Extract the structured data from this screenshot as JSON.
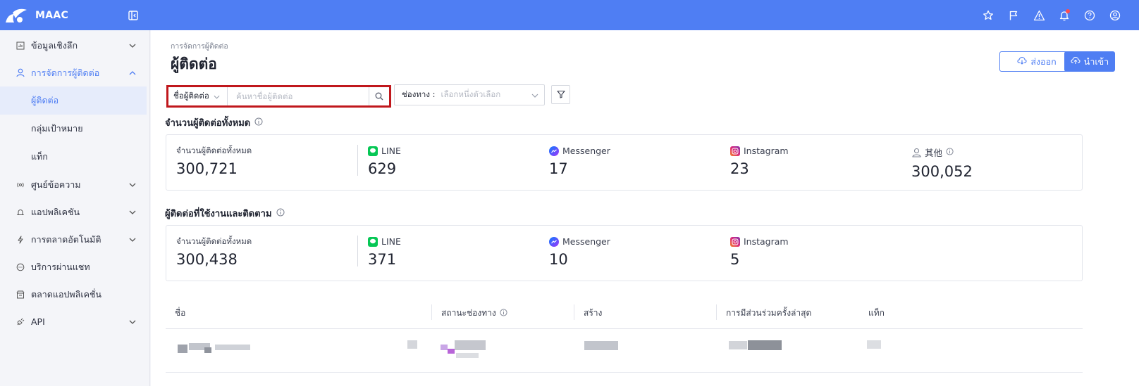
{
  "app": {
    "name": "MAAC",
    "brand_color": "#4f7ef3",
    "top_icons": [
      "star-icon",
      "flag-icon",
      "alert-icon",
      "bell-icon",
      "help-icon",
      "user-icon"
    ]
  },
  "sidebar": {
    "items": [
      {
        "label": "ข้อมูลเชิงลึก",
        "icon": "chart-icon",
        "has_chevron": true
      },
      {
        "label": "การจัดการผู้ติดต่อ",
        "icon": "person-icon",
        "has_chevron": true,
        "expanded": true
      },
      {
        "label": "ศูนย์ข้อความ",
        "icon": "broadcast-icon",
        "has_chevron": true
      },
      {
        "label": "แอปพลิเคชัน",
        "icon": "bell-icon",
        "has_chevron": true
      },
      {
        "label": "การตลาดอัตโนมัติ",
        "icon": "bolt-icon",
        "has_chevron": true
      },
      {
        "label": "บริการผ่านแชท",
        "icon": "chat-icon",
        "has_chevron": false
      },
      {
        "label": "ตลาดแอปพลิเคชั่น",
        "icon": "store-icon",
        "has_chevron": false
      },
      {
        "label": "API",
        "icon": "plug-icon",
        "has_chevron": true
      }
    ],
    "sub_items": [
      {
        "label": "ผู้ติดต่อ",
        "selected": true
      },
      {
        "label": "กลุ่มเป้าหมาย",
        "selected": false
      },
      {
        "label": "แท็ก",
        "selected": false
      }
    ]
  },
  "main": {
    "breadcrumb": "การจัดการผู้ติดต่อ",
    "title": "ผู้ติดต่อ",
    "export_label": "ส่งออก",
    "import_label": "นำเข้า",
    "search": {
      "type_label": "ชื่อผู้ติดต่อ",
      "placeholder": "ค้นหาชื่อผู้ติดต่อ"
    },
    "channel_filter": {
      "label": "ช่องทาง :",
      "placeholder": "เลือกหนึ่งตัวเลือก"
    },
    "total_section": {
      "title": "จำนวนผู้ติดต่อทั้งหมด",
      "total_label": "จำนวนผู้ติดต่อทั้งหมด",
      "total_value": "300,721",
      "channels": [
        {
          "name": "LINE",
          "value": "629",
          "icon": "line-icon"
        },
        {
          "name": "Messenger",
          "value": "17",
          "icon": "messenger-icon"
        },
        {
          "name": "Instagram",
          "value": "23",
          "icon": "instagram-icon"
        },
        {
          "name": "其他",
          "value": "300,052",
          "icon": "person-outline-icon"
        }
      ]
    },
    "active_section": {
      "title": "ผู้ติดต่อที่ใช้งานและติดตาม",
      "total_label": "จำนวนผู้ติดต่อทั้งหมด",
      "total_value": "300,438",
      "channels": [
        {
          "name": "LINE",
          "value": "371",
          "icon": "line-icon"
        },
        {
          "name": "Messenger",
          "value": "10",
          "icon": "messenger-icon"
        },
        {
          "name": "Instagram",
          "value": "5",
          "icon": "instagram-icon"
        }
      ]
    },
    "table": {
      "columns": [
        "ชื่อ",
        "สถานะช่องทาง",
        "สร้าง",
        "การมีส่วนร่วมครั้งล่าสุด",
        "แท็ก"
      ]
    }
  }
}
